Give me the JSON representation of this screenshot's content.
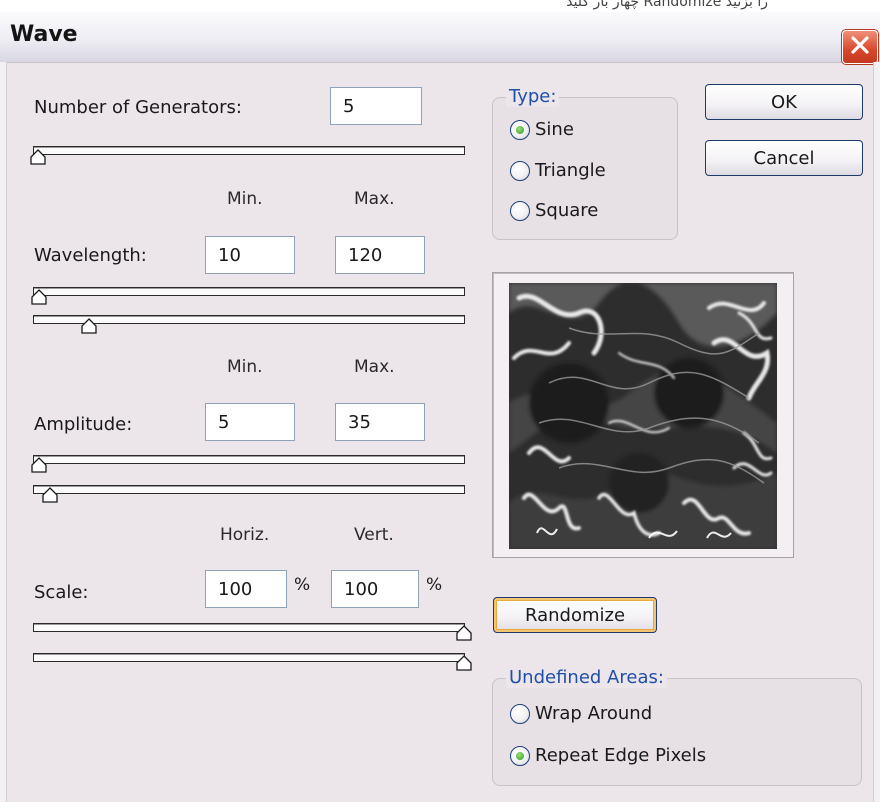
{
  "top_caption": "چهار بار کلید  Randomize  را بزنید",
  "dialog": {
    "title": "Wave"
  },
  "generators": {
    "label": "Number of Generators:",
    "value": "5"
  },
  "column_headers": {
    "min": "Min.",
    "max": "Max.",
    "horiz": "Horiz.",
    "vert": "Vert."
  },
  "wavelength": {
    "label": "Wavelength:",
    "min": "10",
    "max": "120"
  },
  "amplitude": {
    "label": "Amplitude:",
    "min": "5",
    "max": "35"
  },
  "scale": {
    "label": "Scale:",
    "horiz": "100",
    "vert": "100",
    "unit": "%"
  },
  "type_group": {
    "legend": "Type:",
    "options": [
      {
        "label": "Sine",
        "checked": true
      },
      {
        "label": "Triangle",
        "checked": false
      },
      {
        "label": "Square",
        "checked": false
      }
    ]
  },
  "buttons": {
    "ok": "OK",
    "cancel": "Cancel",
    "randomize": "Randomize"
  },
  "undefined_areas": {
    "legend": "Undefined Areas:",
    "options": [
      {
        "label": "Wrap Around",
        "checked": false
      },
      {
        "label": "Repeat Edge Pixels",
        "checked": true
      }
    ]
  },
  "colors": {
    "dialog_bg": "#ece5ea",
    "legend_text": "#1f4fa8",
    "close_button": "#d9472b",
    "field_border": "#8ea2b8",
    "radio_selected": "#2f9a1a"
  }
}
